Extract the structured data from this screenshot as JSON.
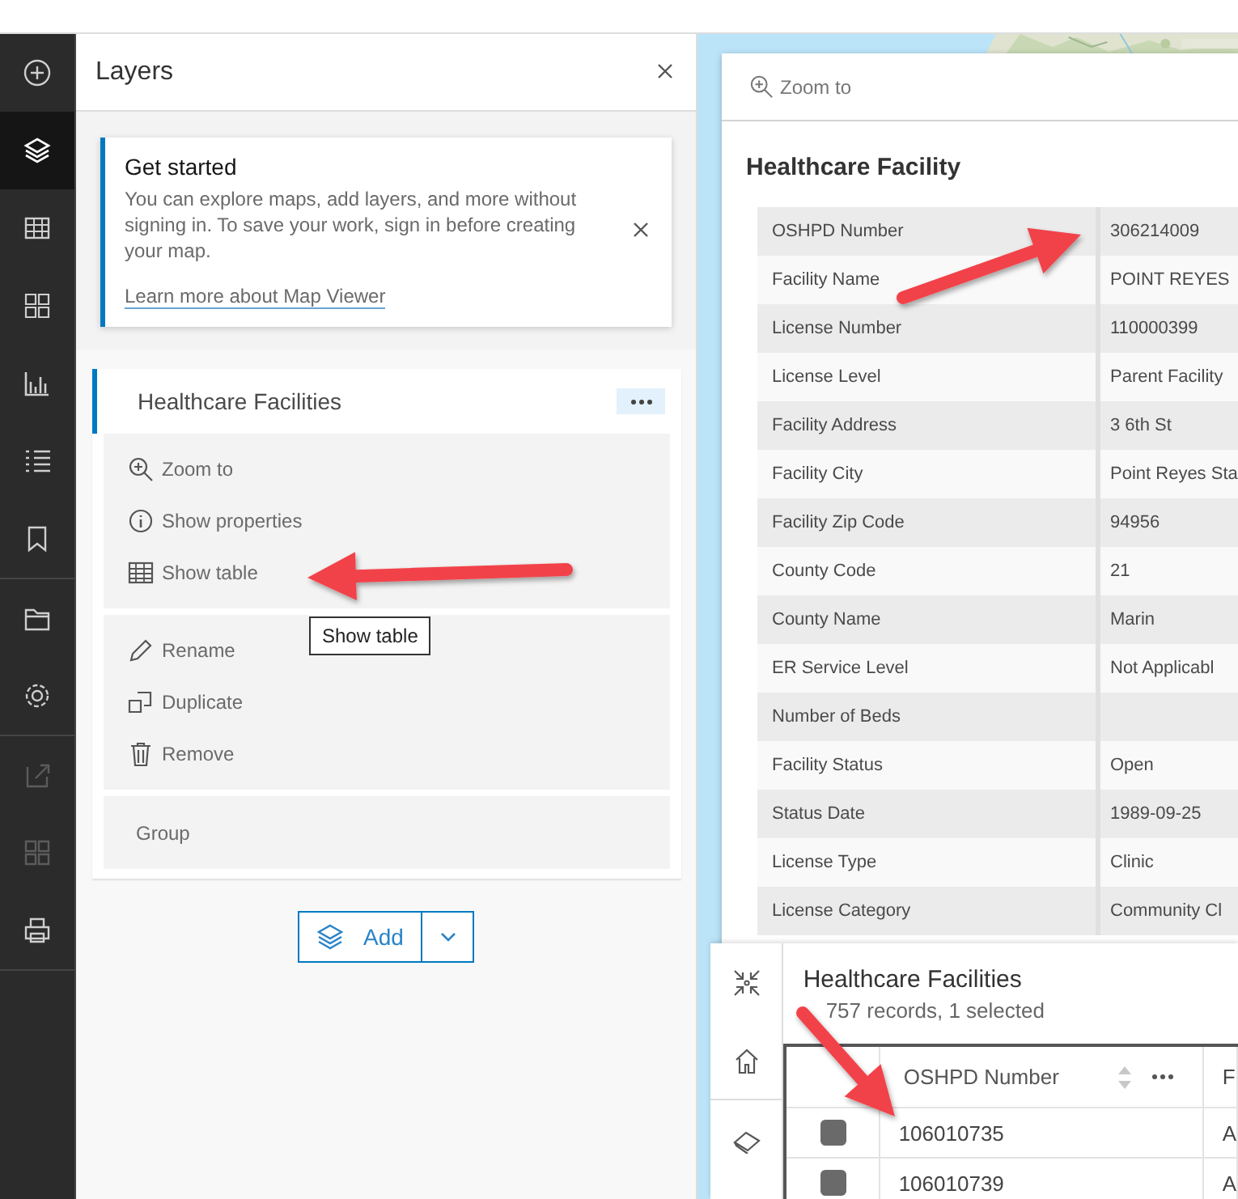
{
  "rail": [
    {
      "items": [
        {
          "selected": false,
          "disabled": false
        },
        {
          "selected": true,
          "disabled": false
        },
        {
          "selected": false,
          "disabled": false
        },
        {
          "selected": false,
          "disabled": false
        },
        {
          "selected": false,
          "disabled": false
        },
        {
          "selected": false,
          "disabled": false
        },
        {
          "selected": false,
          "disabled": false
        }
      ]
    },
    {
      "items": [
        {
          "selected": false,
          "disabled": false
        },
        {
          "selected": false,
          "disabled": false
        }
      ]
    },
    {
      "items": [
        {
          "selected": false,
          "disabled": true
        },
        {
          "selected": false,
          "disabled": true
        },
        {
          "selected": false,
          "disabled": false
        }
      ]
    }
  ],
  "layers_panel": {
    "title": "Layers",
    "notice": {
      "title": "Get started",
      "text": "You can explore maps, add layers, and more without signing in. To save your work, sign in before creating your map.",
      "link": "Learn more about Map Viewer"
    },
    "layer": {
      "name": "Healthcare Facilities",
      "menu_groups": [
        {
          "items": [
            {
              "label": "Zoom to"
            },
            {
              "label": "Show properties"
            },
            {
              "label": "Show table"
            }
          ]
        },
        {
          "items": [
            {
              "label": "Rename"
            },
            {
              "label": "Duplicate"
            },
            {
              "label": "Remove"
            }
          ]
        },
        {
          "items": [
            {
              "label": "Group"
            }
          ]
        }
      ]
    },
    "tooltip": "Show table",
    "add_button": "Add"
  },
  "popup": {
    "toolbar": "Zoom to",
    "title": "Healthcare Facility",
    "fields": [
      {
        "name": "OSHPD Number",
        "value": "306214009"
      },
      {
        "name": "Facility Name",
        "value": "POINT REYES"
      },
      {
        "name": "License Number",
        "value": "110000399"
      },
      {
        "name": "License Level",
        "value": "Parent Facility"
      },
      {
        "name": "Facility Address",
        "value": "3 6th St"
      },
      {
        "name": "Facility City",
        "value": "Point Reyes Sta"
      },
      {
        "name": "Facility Zip Code",
        "value": "94956"
      },
      {
        "name": "County Code",
        "value": "21"
      },
      {
        "name": "County Name",
        "value": "Marin"
      },
      {
        "name": "ER Service Level",
        "value": "Not Applicabl"
      },
      {
        "name": "Number of Beds"
      },
      {
        "name": "Facility Status",
        "value": "Open"
      },
      {
        "name": "Status Date",
        "value": "1989-09-25"
      },
      {
        "name": "License Type",
        "value": "Clinic"
      },
      {
        "name": "License Category",
        "value": "Community Cl"
      }
    ]
  },
  "table_panel": {
    "title": "Healthcare Facilities",
    "subtitle": "757 records, 1 selected",
    "columns": [
      "OSHPD Number",
      "F"
    ],
    "rows": [
      {
        "selected": false,
        "cells": [
          "106010735",
          "A"
        ]
      },
      {
        "selected": false,
        "cells": [
          "106010739",
          "A"
        ]
      }
    ]
  }
}
